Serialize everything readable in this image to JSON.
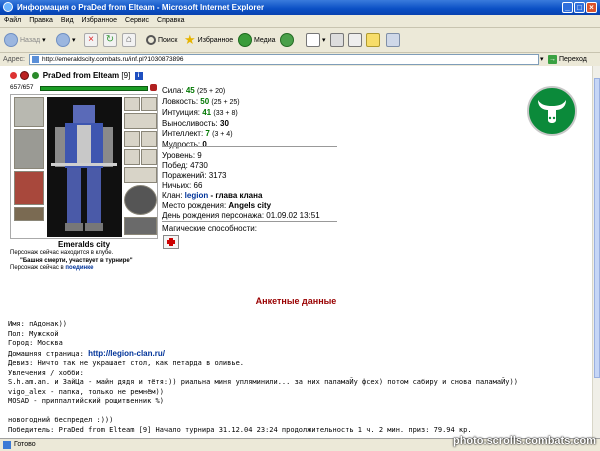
{
  "window": {
    "title": "Информация о PraDed from Elteam - Microsoft Internet Explorer"
  },
  "menu": [
    "Файл",
    "Правка",
    "Вид",
    "Избранное",
    "Сервис",
    "Справка"
  ],
  "toolbar": {
    "back": "Назад",
    "search": "Поиск",
    "favorites": "Избранное",
    "media": "Медиа"
  },
  "address": {
    "label": "Адрес:",
    "url": "http://emeraldscity.combats.ru/inf.pl?1030873896",
    "go": "Переход"
  },
  "character": {
    "name": "PraDed from Elteam",
    "level_tag": "[9]",
    "hp": "657/657",
    "city": "Emeralds city",
    "location_line1": "Персонаж сейчас находится в клубе.",
    "location_line2": "\"Башня смерти, участвует в турнире\"",
    "location_line3_prefix": "Персонаж сейчас в",
    "location_line3_link": "поединке"
  },
  "stats": [
    {
      "label": "Сила:",
      "value": "45",
      "bonus": "(25 + 20)"
    },
    {
      "label": "Ловкость:",
      "value": "50",
      "bonus": "(25 + 25)"
    },
    {
      "label": "Интуиция:",
      "value": "41",
      "bonus": "(33 + 8)"
    },
    {
      "label": "Выносливость:",
      "value": "30",
      "bonus": ""
    },
    {
      "label": "Интеллект:",
      "value": "7",
      "bonus": "(3 + 4)"
    },
    {
      "label": "Мудрость:",
      "value": "0",
      "bonus": ""
    }
  ],
  "info": {
    "level": "Уровень: 9",
    "wins": "Побед: 4730",
    "losses": "Поражений: 3173",
    "draws": "Ничьих: 66",
    "clan_label": "Клан:",
    "clan_name": "legion",
    "clan_role": "- глава клана",
    "birthplace_label": "Место рождения:",
    "birthplace": "Angels city",
    "birthday": "День рождения персонажа: 01.09.02 13:51",
    "magic": "Магические способности:"
  },
  "profile": {
    "title": "Анкетные данные",
    "name": "Имя: пAдонак))",
    "gender": "Пол: Мужской",
    "city": "Город: Москва",
    "homepage_label": "Домашняя страница:",
    "homepage": "http://legion-clan.ru/",
    "motto": "Девиз: Ничто так не украшает стол, как петарда в оливье.",
    "hobbies_label": "Увлечения / хобби:",
    "hobby1": "S.h.am.an. и ЗайЦа - майн дядя и тётя:)) риальна миня упляминили... за них паламаЙу фсех) потом сабиру и снова паламаЙу))",
    "hobby2": "vigo_alex - папка, только не ремнём))",
    "hobby3": "MOSAD - приппалтийский рощитвенник %)",
    "newyear": "новогодний беспредел :)))",
    "winner": "Победитель: PraDed from Elteam [9] Начало турнира 31.12.04 23:24 продолжительность 1 ч. 2 мин. приз: 79.94 кр."
  },
  "status": {
    "text": "Готово",
    "watermark": "photo.scrolls.combats.com"
  }
}
